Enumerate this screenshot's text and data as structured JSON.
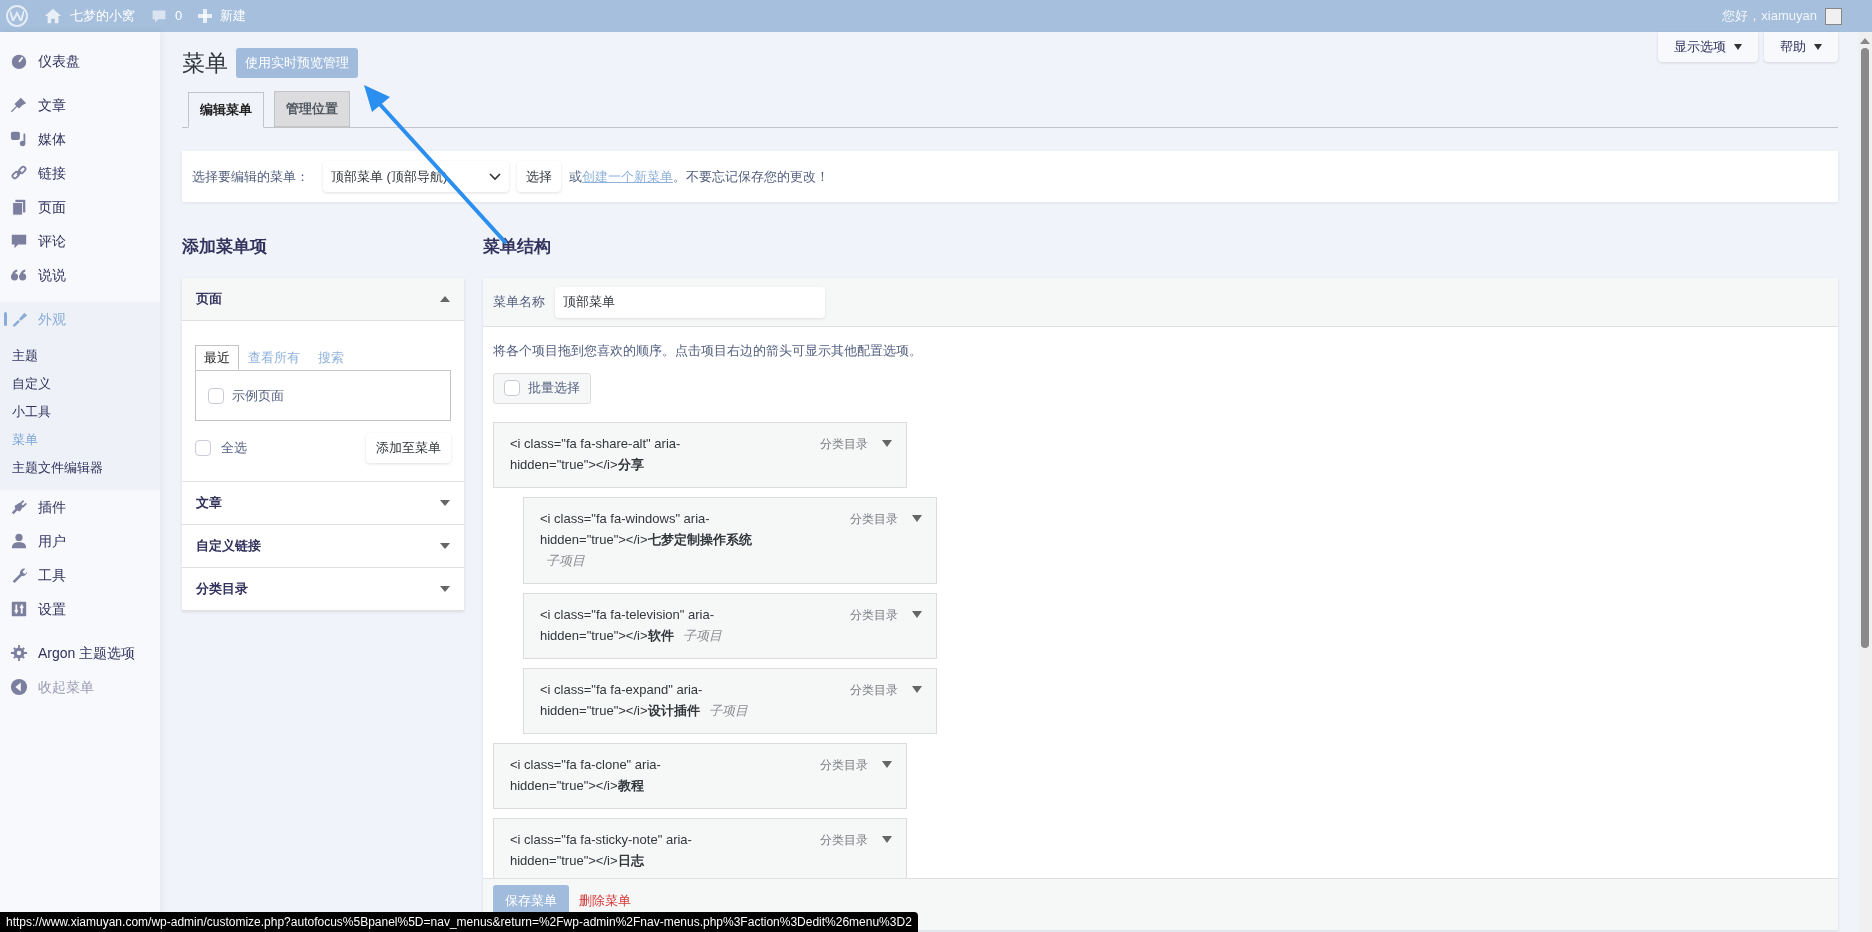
{
  "admin_bar": {
    "site_name": "七梦的小窝",
    "comments": "0",
    "new_label": "新建",
    "greeting": "您好，xiamuyan"
  },
  "sidebar": {
    "groups": [
      [
        {
          "label": "仪表盘",
          "kind": "dashboard",
          "selected": false
        }
      ],
      [
        {
          "label": "文章",
          "kind": "pin",
          "selected": false
        },
        {
          "label": "媒体",
          "kind": "media",
          "selected": false
        },
        {
          "label": "链接",
          "kind": "link",
          "selected": false
        },
        {
          "label": "页面",
          "kind": "page",
          "selected": false
        },
        {
          "label": "评论",
          "kind": "comment",
          "selected": false
        },
        {
          "label": "说说",
          "kind": "quote",
          "selected": false
        }
      ],
      [
        {
          "label": "外观",
          "kind": "brush",
          "selected": true,
          "children": [
            {
              "label": "主题",
              "selected": false
            },
            {
              "label": "自定义",
              "selected": false
            },
            {
              "label": "小工具",
              "selected": false
            },
            {
              "label": "菜单",
              "selected": true
            },
            {
              "label": "主题文件编辑器",
              "selected": false
            }
          ]
        },
        {
          "label": "插件",
          "kind": "plugin",
          "selected": false
        },
        {
          "label": "用户",
          "kind": "user",
          "selected": false
        },
        {
          "label": "工具",
          "kind": "wrench",
          "selected": false
        },
        {
          "label": "设置",
          "kind": "settings",
          "selected": false
        }
      ],
      [
        {
          "label": "Argon 主题选项",
          "kind": "gear",
          "selected": false
        },
        {
          "label": "收起菜单",
          "kind": "collapse",
          "selected": false
        }
      ]
    ]
  },
  "screen_options": "显示选项",
  "help": "帮助",
  "title": "菜单",
  "preview_button": "使用实时预览管理",
  "tabs": [
    {
      "label": "编辑菜单",
      "selected": true
    },
    {
      "label": "管理位置",
      "selected": false
    }
  ],
  "select_bar": {
    "label": "选择要编辑的菜单：",
    "value": "顶部菜单 (顶部导航)",
    "button": "选择",
    "note": "或",
    "link": "创建一个新菜单",
    "note_end": "。不要忘记保存您的更改！"
  },
  "add_items": {
    "heading": "添加菜单项",
    "sections": [
      {
        "title": "页面",
        "expanded": true,
        "tabs": [
          {
            "label": "最近",
            "selected": true
          },
          {
            "label": "查看所有",
            "selected": false
          },
          {
            "label": "搜索",
            "selected": false
          }
        ],
        "items": [
          {
            "label": "示例页面",
            "checked": false
          }
        ],
        "select_all": {
          "label": "全选",
          "checked": false
        },
        "button": "添加至菜单"
      },
      {
        "title": "文章",
        "expanded": false
      },
      {
        "title": "自定义链接",
        "expanded": false
      },
      {
        "title": "分类目录",
        "expanded": false
      }
    ]
  },
  "structure": {
    "heading": "菜单结构",
    "name_label": "菜单名称",
    "name_value": "顶部菜单",
    "instructions": "将各个项目拖到您喜欢的顺序。点击项目右边的箭头可显示其他配置选项。",
    "bulk_select": {
      "label": "批量选择",
      "checked": false
    },
    "items": [
      {
        "title": "<i class=\"fa fa-share-alt\" aria-hidden=\"true\"></i>**分享**",
        "type": "分类目录",
        "children": [
          {
            "title": "<i class=\"fa fa-windows\" aria-hidden=\"true\"></i>**七梦定制操作系统**",
            "sub_label": "子项目",
            "type": "分类目录"
          },
          {
            "title": "<i class=\"fa fa-television\" aria-hidden=\"true\"></i>**软件**",
            "sub_label": "子项目",
            "type": "分类目录"
          },
          {
            "title": "<i class=\"fa fa-expand\" aria-hidden=\"true\"></i>**设计插件**",
            "sub_label": "子项目",
            "type": "分类目录"
          }
        ]
      },
      {
        "title": "<i class=\"fa fa-clone\" aria-hidden=\"true\"></i>**教程**",
        "type": "分类目录"
      },
      {
        "title": "<i class=\"fa fa-sticky-note\" aria-hidden=\"true\"></i>**日志**",
        "type": "分类目录"
      }
    ],
    "save_button": "保存菜单",
    "delete_link": "删除菜单"
  },
  "status_url": "https://www.xiamuyan.com/wp-admin/customize.php?autofocus%5Bpanel%5D=nav_menus&return=%2Fwp-admin%2Fnav-menus.php%3Faction%3Dedit%26menu%3D2"
}
